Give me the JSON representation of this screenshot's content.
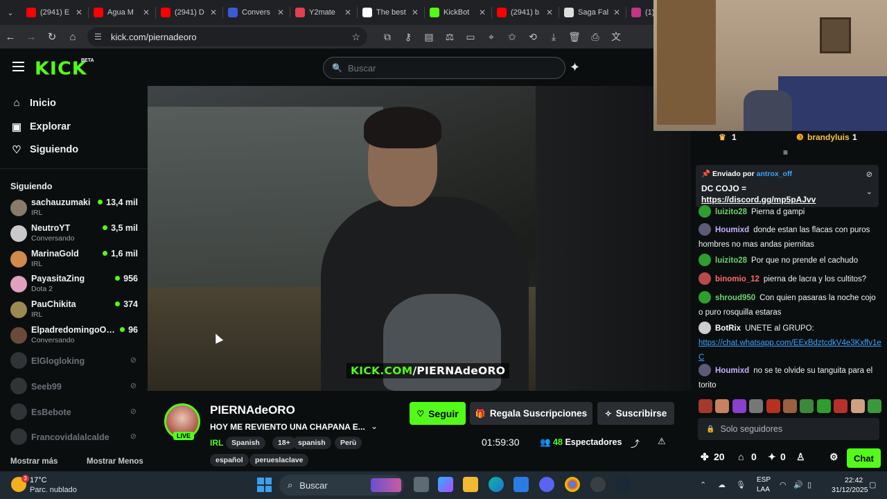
{
  "browser": {
    "tabs": [
      {
        "label": "(2941) E",
        "color": "#ff0000"
      },
      {
        "label": "Agua M",
        "color": "#ff0000"
      },
      {
        "label": "(2941) D",
        "color": "#ff0000"
      },
      {
        "label": "Convers",
        "color": "#3a5bd9"
      },
      {
        "label": "Y2mate",
        "color": "#e04050"
      },
      {
        "label": "The best",
        "color": "#ffffff"
      },
      {
        "label": "KickBot",
        "color": "#53fc18"
      },
      {
        "label": "(2941) b",
        "color": "#ff0000"
      },
      {
        "label": "Saga Fal",
        "color": "#dddddd"
      },
      {
        "label": "(1)",
        "color": "#c13584"
      }
    ],
    "url": "kick.com/piernadeoro"
  },
  "kick": {
    "logo": "KICK",
    "beta": "BETA",
    "search_placeholder": "Buscar",
    "nav": {
      "home": "Inicio",
      "explore": "Explorar",
      "following": "Siguiendo"
    },
    "following_title": "Siguiendo",
    "channels_live": [
      {
        "name": "sachauzumaki",
        "category": "IRL",
        "viewers": "13,4 mil",
        "color": "#8a7a6a"
      },
      {
        "name": "NeutroYT",
        "category": "Conversando",
        "viewers": "3,5 mil",
        "color": "#c9c9c9"
      },
      {
        "name": "MarinaGold",
        "category": "IRL",
        "viewers": "1,6 mil",
        "color": "#d08a4a"
      },
      {
        "name": "PayasitaZing",
        "category": "Dota 2",
        "viewers": "956",
        "color": "#e0a0c0"
      },
      {
        "name": "PauChikita",
        "category": "IRL",
        "viewers": "374",
        "color": "#9a8a50"
      },
      {
        "name": "ElpadredomingoOfi...",
        "category": "Conversando",
        "viewers": "96",
        "color": "#6a4a3a"
      }
    ],
    "channels_offline": [
      {
        "name": "ElGlogloking"
      },
      {
        "name": "Seeb99"
      },
      {
        "name": "EsBebote"
      },
      {
        "name": "Francovidalalcalde"
      }
    ],
    "show_more": "Mostrar más",
    "show_less": "Mostrar Menos"
  },
  "stream": {
    "watermark_green": "KICK.COM",
    "watermark_white": "/PIERNAdeORO",
    "live_label": "LIVE",
    "streamer": "PIERNAdeORO",
    "title": "HOY ME REVIENTO UNA CHAPANA E...",
    "category": "IRL",
    "tags_row1": [
      "Spanish",
      "18+",
      "spanish",
      "Perù"
    ],
    "tags_row2": [
      "español",
      "perueslaclave"
    ],
    "follow": "Seguir",
    "gift": "Regala Suscripciones",
    "subscribe": "Suscribirse",
    "uptime": "01:59:30",
    "viewers": "48",
    "viewers_label": "Espectadores"
  },
  "chat": {
    "top_left_count": "1",
    "top_user": "brandyluis",
    "top_user_count": "1",
    "pinned": {
      "prefix": "Enviado por",
      "by": "antrox_off",
      "line1": "DC COJO =",
      "link": "https://discord.gg/mp5pAJvv"
    },
    "messages": [
      {
        "user": "luizito28",
        "text": "Pierna d gampi",
        "color": "#6fd36f",
        "badge": "#2e9e2e"
      },
      {
        "user": "Houmixd",
        "text": "donde estan las flacas con puros hombres no mas andas piernitas",
        "color": "#c7b3ff",
        "badge": "#5d5a77"
      },
      {
        "user": "luizito28",
        "text": "Por que no prende el cachudo",
        "color": "#6fd36f",
        "badge": "#2e9e2e"
      },
      {
        "user": "binomio_12",
        "text": "pierna de lacra y los cultitos?",
        "color": "#ff6b6b",
        "badge": "#b84a4a"
      },
      {
        "user": "shroud950",
        "text": "Con quien pasaras la noche cojo o puro rosquilla estaras",
        "color": "#6fd36f",
        "badge": "#2e9e2e"
      },
      {
        "user": "BotRix",
        "text": "UNETE al GRUPO:",
        "link": "https://chat.whatsapp.com/EExBdztcdkV4e3Kxffv1eC",
        "color": "#ffffff",
        "badge": "#cfcfcf"
      },
      {
        "user": "Houmixd",
        "text": "no se te olvide su tanguita para el torito",
        "color": "#c7b3ff",
        "badge": "#5d5a77"
      }
    ],
    "input_placeholder": "Solo seguidores",
    "stats": {
      "kicks": "20",
      "gifts": "0",
      "subs": "0"
    },
    "chat_button": "Chat"
  },
  "taskbar": {
    "temp": "17°C",
    "weather": "Parc. nublado",
    "weather_badge": "3",
    "search": "Buscar",
    "lang1": "ESP",
    "lang2": "LAA",
    "time": "22:42",
    "date": "31/12/2025"
  }
}
